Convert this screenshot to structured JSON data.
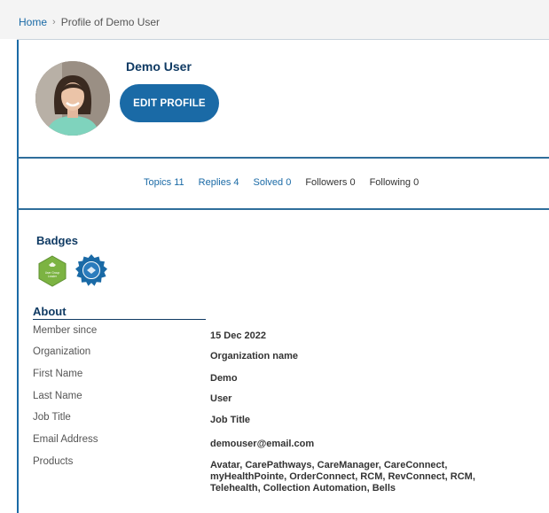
{
  "breadcrumb": {
    "home": "Home",
    "separator": "›",
    "current": "Profile of Demo User"
  },
  "profile": {
    "name": "Demo User",
    "edit_button": "EDIT PROFILE"
  },
  "stats": [
    {
      "label": "Topics 11"
    },
    {
      "label": "Replies 4"
    },
    {
      "label": "Solved 0"
    },
    {
      "label": "Followers 0"
    },
    {
      "label": "Following 0"
    }
  ],
  "badges": {
    "title": "Badges",
    "items": [
      {
        "icon": "hexagon-badge-icon",
        "color": "#7cb342",
        "text": "User Group Leader"
      },
      {
        "icon": "rosette-badge-icon",
        "color": "#1a6aa6"
      }
    ]
  },
  "about": {
    "title": "About",
    "rows": [
      {
        "label": "Member since",
        "value": "15 Dec 2022"
      },
      {
        "label": "Organization",
        "value": "Organization name"
      },
      {
        "label": "First Name",
        "value": "Demo"
      },
      {
        "label": "Last Name",
        "value": "User"
      },
      {
        "label": "Job Title",
        "value": "Job Title"
      },
      {
        "label": "Email Address",
        "value": "demouser@email.com"
      },
      {
        "label": "Products",
        "value": "Avatar, CarePathways, CareManager, CareConnect, myHealthPointe, OrderConnect, RCM, RevConnect, RCM, Telehealth, Collection Automation, Bells"
      }
    ]
  },
  "colors": {
    "accent": "#1a6aa6",
    "heading": "#0f3a63"
  }
}
